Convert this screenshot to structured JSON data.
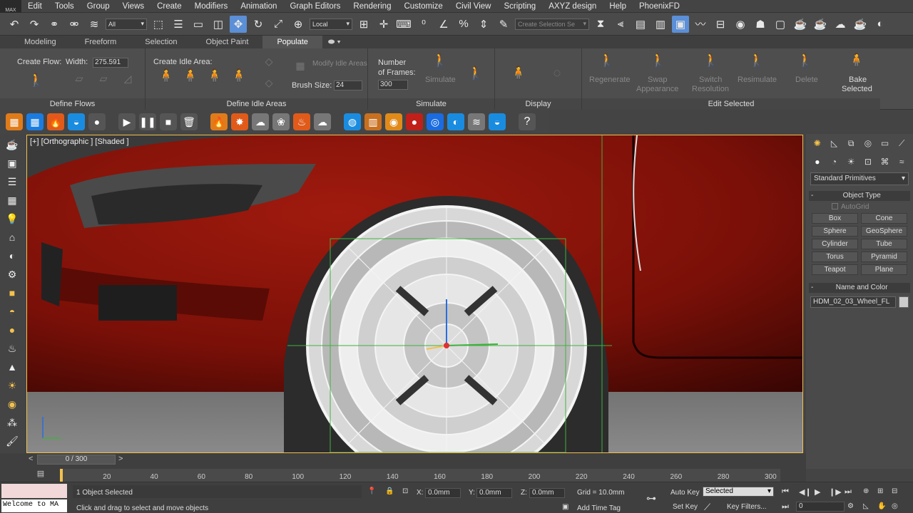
{
  "menu": {
    "logo": "MAX",
    "items": [
      "Edit",
      "Tools",
      "Group",
      "Views",
      "Create",
      "Modifiers",
      "Animation",
      "Graph Editors",
      "Rendering",
      "Customize",
      "Civil View",
      "Scripting",
      "AXYZ design",
      "Help",
      "PhoenixFD"
    ]
  },
  "toolbar": {
    "filter_value": "All",
    "coord_value": "Local",
    "selection_set_placeholder": "Create Selection Se"
  },
  "ribbon": {
    "tabs": [
      "Modeling",
      "Freeform",
      "Selection",
      "Object Paint",
      "Populate"
    ],
    "active_tab": "Populate",
    "define_flows": {
      "create_flow": "Create Flow:",
      "width_label": "Width:",
      "width_value": "275.591",
      "title": "Define Flows"
    },
    "define_idle": {
      "create_idle": "Create Idle Area:",
      "modify_idle": "Modify Idle Areas",
      "brush_label": "Brush Size:",
      "brush_value": "24",
      "title": "Define Idle Areas"
    },
    "simulate": {
      "frames_label_1": "Number",
      "frames_label_2": "of Frames:",
      "frames_value": "300",
      "simulate_label": "Simulate",
      "title": "Simulate"
    },
    "display": {
      "title": "Display"
    },
    "edit_selected": {
      "regenerate": "Regenerate",
      "swap_1": "Swap",
      "swap_2": "Appearance",
      "switch_1": "Switch",
      "switch_2": "Resolution",
      "resimulate": "Resimulate",
      "delete": "Delete",
      "bake_1": "Bake",
      "bake_2": "Selected",
      "title": "Edit Selected"
    }
  },
  "viewport": {
    "label": "[+] [Orthographic ] [Shaded ]"
  },
  "command_panel": {
    "dropdown": "Standard Primitives",
    "object_type_title": "Object Type",
    "autogrid": "AutoGrid",
    "buttons": [
      "Box",
      "Cone",
      "Sphere",
      "GeoSphere",
      "Cylinder",
      "Tube",
      "Torus",
      "Pyramid",
      "Teapot",
      "Plane"
    ],
    "name_color_title": "Name and Color",
    "object_name": "HDM_02_03_Wheel_FL",
    "object_color": "#cccccc"
  },
  "timeline": {
    "slider_text": "0 / 300",
    "ticks": [
      "20",
      "40",
      "60",
      "80",
      "100",
      "120",
      "140",
      "160",
      "180",
      "200",
      "220",
      "240",
      "260",
      "280",
      "300"
    ]
  },
  "status": {
    "maxscript": "Welcome to MA",
    "selected": "1 Object Selected",
    "prompt": "Click and drag to select and move objects",
    "x_label": "X:",
    "x_value": "0.0mm",
    "y_label": "Y:",
    "y_value": "0.0mm",
    "z_label": "Z:",
    "z_value": "0.0mm",
    "grid": "Grid = 10.0mm",
    "add_time_tag": "Add Time Tag",
    "auto_key": "Auto Key",
    "selected_dropdown": "Selected",
    "set_key": "Set Key",
    "key_filters": "Key Filters...",
    "frame_value": "0"
  }
}
